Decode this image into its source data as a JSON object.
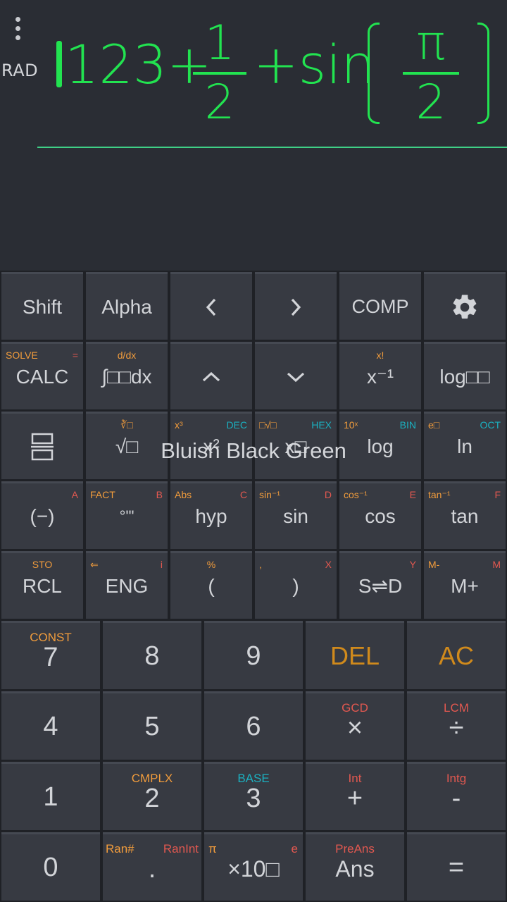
{
  "display": {
    "mode": "RAD",
    "expr_prefix": "123+",
    "frac1_num": "1",
    "frac1_den": "2",
    "expr_mid": "+sin",
    "frac2_num": "π",
    "frac2_den": "2",
    "text_color": "#22e350"
  },
  "toolbar": {
    "shift": "Shift",
    "alpha": "Alpha",
    "left": "<",
    "right": ">",
    "comp": "COMP",
    "settings_icon": "gear-icon"
  },
  "row2": {
    "calc": "CALC",
    "calc_shift": "SOLVE",
    "calc_alpha": "=",
    "integral": "∫□□dx",
    "integral_shift": "d/dx",
    "up_icon": "chevron-up-icon",
    "down_icon": "chevron-down-icon",
    "xinv": "x⁻¹",
    "xinv_shift": "x!",
    "logb": "log□□"
  },
  "row3": {
    "frac_icon": "fraction-icon",
    "sqrt": "√□",
    "sqrt_shift": "∛□",
    "sq": "x²",
    "sq_shift": "x³",
    "sq_alpha": "DEC",
    "pow": "x□",
    "pow_shift": "□√□",
    "pow_alpha": "HEX",
    "log": "log",
    "log_shift": "10ˣ",
    "log_alpha": "BIN",
    "ln": "ln",
    "ln_shift": "e□",
    "ln_alpha": "OCT"
  },
  "row4": {
    "neg": "(−)",
    "neg_alpha": "A",
    "deg": "°'\"",
    "deg_shift": "FACT",
    "deg_alpha": "B",
    "hyp": "hyp",
    "hyp_shift": "Abs",
    "hyp_alpha": "C",
    "sin": "sin",
    "sin_shift": "sin⁻¹",
    "sin_alpha": "D",
    "cos": "cos",
    "cos_shift": "cos⁻¹",
    "cos_alpha": "E",
    "tan": "tan",
    "tan_shift": "tan⁻¹",
    "tan_alpha": "F"
  },
  "row5": {
    "rcl": "RCL",
    "rcl_shift": "STO",
    "eng": "ENG",
    "eng_shift": "⇐",
    "eng_alpha": "i",
    "lparen": "(",
    "lparen_shift": "%",
    "rparen": ")",
    "rparen_shift": ",",
    "rparen_alpha": "X",
    "sd": "S⇌D",
    "sd_alpha": "Y",
    "mplus": "M+",
    "mplus_shift": "M-",
    "mplus_alpha": "M"
  },
  "numpad": {
    "k7": "7",
    "k7_shift": "CONST",
    "k8": "8",
    "k9": "9",
    "del": "DEL",
    "ac": "AC",
    "k4": "4",
    "k5": "5",
    "k6": "6",
    "mul": "×",
    "mul_shift": "GCD",
    "div": "÷",
    "div_shift": "LCM",
    "k1": "1",
    "k2": "2",
    "k2_shift": "CMPLX",
    "k3": "3",
    "k3_shift": "BASE",
    "plus": "+",
    "plus_shift": "Int",
    "minus": "-",
    "minus_shift": "Intg",
    "k0": "0",
    "dot": ".",
    "dot_shift": "Ran#",
    "dot_alpha": "RanInt",
    "exp": "×10□",
    "exp_shift": "π",
    "exp_alpha": "e",
    "ans": "Ans",
    "ans_shift": "PreAns",
    "eq": "="
  },
  "toast": "Bluish Black Green"
}
